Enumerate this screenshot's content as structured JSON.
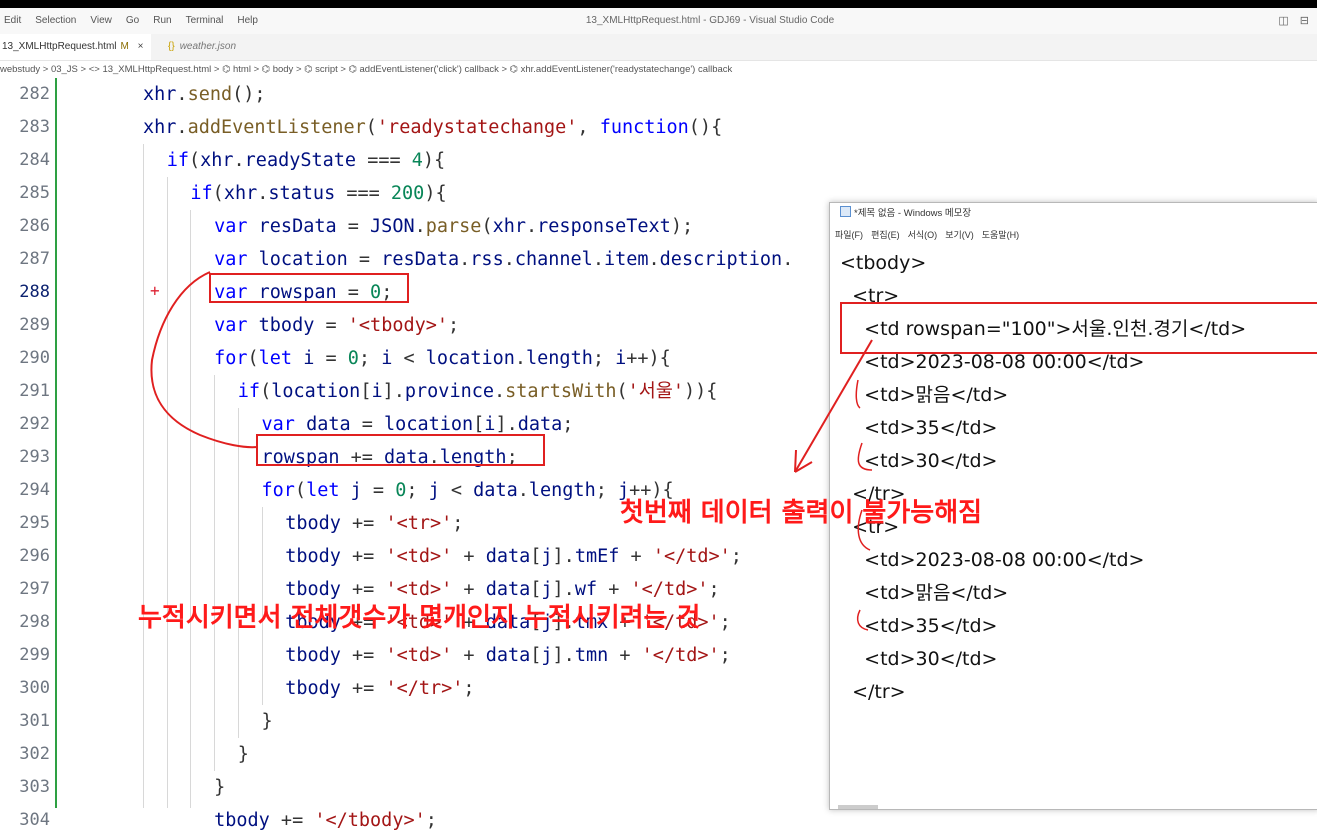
{
  "menubar": {
    "items": [
      "Edit",
      "Selection",
      "View",
      "Go",
      "Run",
      "Terminal",
      "Help"
    ],
    "window_title": "13_XMLHttpRequest.html - GDJ69 - Visual Studio Code",
    "layout_icons": "◫ ⊟"
  },
  "tabs": {
    "active": {
      "name": "13_XMLHttpRequest.html",
      "mod": "M",
      "close": "×"
    },
    "inactive": {
      "icon": "{}",
      "name": "weather.json"
    }
  },
  "breadcrumb": "webstudy > 03_JS > <> 13_XMLHttpRequest.html > ⌬ html > ⌬ body > ⌬ script > ⌬ addEventListener('click') callback > ⌬ xhr.addEventListener('readystatechange') callback",
  "editor": {
    "current_line": 288,
    "added_marker": "+",
    "lines": [
      {
        "n": "282",
        "indent": 0,
        "tokens": [
          [
            "var",
            "xhr"
          ],
          [
            "p",
            "."
          ],
          [
            "fn",
            "send"
          ],
          [
            "p",
            "();"
          ]
        ]
      },
      {
        "n": "283",
        "indent": 0,
        "tokens": [
          [
            "var",
            "xhr"
          ],
          [
            "p",
            "."
          ],
          [
            "fn",
            "addEventListener"
          ],
          [
            "p",
            "("
          ],
          [
            "str",
            "'readystatechange'"
          ],
          [
            "p",
            ", "
          ],
          [
            "kw",
            "function"
          ],
          [
            "p",
            "(){"
          ]
        ]
      },
      {
        "n": "284",
        "indent": 1,
        "tokens": [
          [
            "kw",
            "if"
          ],
          [
            "p",
            "("
          ],
          [
            "var",
            "xhr"
          ],
          [
            "p",
            "."
          ],
          [
            "var",
            "readyState"
          ],
          [
            "p",
            " === "
          ],
          [
            "num",
            "4"
          ],
          [
            "p",
            "){"
          ]
        ]
      },
      {
        "n": "285",
        "indent": 2,
        "tokens": [
          [
            "kw",
            "if"
          ],
          [
            "p",
            "("
          ],
          [
            "var",
            "xhr"
          ],
          [
            "p",
            "."
          ],
          [
            "var",
            "status"
          ],
          [
            "p",
            " === "
          ],
          [
            "num",
            "200"
          ],
          [
            "p",
            "){"
          ]
        ]
      },
      {
        "n": "286",
        "indent": 3,
        "tokens": [
          [
            "kw",
            "var"
          ],
          [
            "p",
            " "
          ],
          [
            "var",
            "resData"
          ],
          [
            "p",
            " = "
          ],
          [
            "var",
            "JSON"
          ],
          [
            "p",
            "."
          ],
          [
            "fn",
            "parse"
          ],
          [
            "p",
            "("
          ],
          [
            "var",
            "xhr"
          ],
          [
            "p",
            "."
          ],
          [
            "var",
            "responseText"
          ],
          [
            "p",
            ");"
          ]
        ]
      },
      {
        "n": "287",
        "indent": 3,
        "tokens": [
          [
            "kw",
            "var"
          ],
          [
            "p",
            " "
          ],
          [
            "var",
            "location"
          ],
          [
            "p",
            " = "
          ],
          [
            "var",
            "resData"
          ],
          [
            "p",
            "."
          ],
          [
            "var",
            "rss"
          ],
          [
            "p",
            "."
          ],
          [
            "var",
            "channel"
          ],
          [
            "p",
            "."
          ],
          [
            "var",
            "item"
          ],
          [
            "p",
            "."
          ],
          [
            "var",
            "description"
          ],
          [
            "p",
            "."
          ]
        ]
      },
      {
        "n": "288",
        "indent": 3,
        "tokens": [
          [
            "kw",
            "var"
          ],
          [
            "p",
            " "
          ],
          [
            "var",
            "rowspan"
          ],
          [
            "p",
            " = "
          ],
          [
            "num",
            "0"
          ],
          [
            "p",
            ";"
          ]
        ]
      },
      {
        "n": "289",
        "indent": 3,
        "tokens": [
          [
            "kw",
            "var"
          ],
          [
            "p",
            " "
          ],
          [
            "var",
            "tbody"
          ],
          [
            "p",
            " = "
          ],
          [
            "str",
            "'<tbody>'"
          ],
          [
            "p",
            ";"
          ]
        ]
      },
      {
        "n": "290",
        "indent": 3,
        "tokens": [
          [
            "kw",
            "for"
          ],
          [
            "p",
            "("
          ],
          [
            "kw",
            "let"
          ],
          [
            "p",
            " "
          ],
          [
            "var",
            "i"
          ],
          [
            "p",
            " = "
          ],
          [
            "num",
            "0"
          ],
          [
            "p",
            "; "
          ],
          [
            "var",
            "i"
          ],
          [
            "p",
            " < "
          ],
          [
            "var",
            "location"
          ],
          [
            "p",
            "."
          ],
          [
            "var",
            "length"
          ],
          [
            "p",
            "; "
          ],
          [
            "var",
            "i"
          ],
          [
            "p",
            "++){"
          ]
        ]
      },
      {
        "n": "291",
        "indent": 4,
        "tokens": [
          [
            "kw",
            "if"
          ],
          [
            "p",
            "("
          ],
          [
            "var",
            "location"
          ],
          [
            "p",
            "["
          ],
          [
            "var",
            "i"
          ],
          [
            "p",
            "]."
          ],
          [
            "var",
            "province"
          ],
          [
            "p",
            "."
          ],
          [
            "fn",
            "startsWith"
          ],
          [
            "p",
            "("
          ],
          [
            "str",
            "'서울'"
          ],
          [
            "p",
            "))"
          ],
          [
            "p",
            "{"
          ]
        ]
      },
      {
        "n": "292",
        "indent": 5,
        "tokens": [
          [
            "kw",
            "var"
          ],
          [
            "p",
            " "
          ],
          [
            "var",
            "data"
          ],
          [
            "p",
            " = "
          ],
          [
            "var",
            "location"
          ],
          [
            "p",
            "["
          ],
          [
            "var",
            "i"
          ],
          [
            "p",
            "]."
          ],
          [
            "var",
            "data"
          ],
          [
            "p",
            ";"
          ]
        ]
      },
      {
        "n": "293",
        "indent": 5,
        "tokens": [
          [
            "var",
            "rowspan"
          ],
          [
            "p",
            " += "
          ],
          [
            "var",
            "data"
          ],
          [
            "p",
            "."
          ],
          [
            "var",
            "length"
          ],
          [
            "p",
            ";"
          ]
        ]
      },
      {
        "n": "294",
        "indent": 5,
        "tokens": [
          [
            "kw",
            "for"
          ],
          [
            "p",
            "("
          ],
          [
            "kw",
            "let"
          ],
          [
            "p",
            " "
          ],
          [
            "var",
            "j"
          ],
          [
            "p",
            " = "
          ],
          [
            "num",
            "0"
          ],
          [
            "p",
            "; "
          ],
          [
            "var",
            "j"
          ],
          [
            "p",
            " < "
          ],
          [
            "var",
            "data"
          ],
          [
            "p",
            "."
          ],
          [
            "var",
            "length"
          ],
          [
            "p",
            "; "
          ],
          [
            "var",
            "j"
          ],
          [
            "p",
            "++){"
          ]
        ]
      },
      {
        "n": "295",
        "indent": 6,
        "tokens": [
          [
            "var",
            "tbody"
          ],
          [
            "p",
            " += "
          ],
          [
            "str",
            "'<tr>'"
          ],
          [
            "p",
            ";"
          ]
        ]
      },
      {
        "n": "296",
        "indent": 6,
        "tokens": [
          [
            "var",
            "tbody"
          ],
          [
            "p",
            " += "
          ],
          [
            "str",
            "'<td>'"
          ],
          [
            "p",
            " + "
          ],
          [
            "var",
            "data"
          ],
          [
            "p",
            "["
          ],
          [
            "var",
            "j"
          ],
          [
            "p",
            "]."
          ],
          [
            "var",
            "tmEf"
          ],
          [
            "p",
            " + "
          ],
          [
            "str",
            "'</td>'"
          ],
          [
            "p",
            ";"
          ]
        ]
      },
      {
        "n": "297",
        "indent": 6,
        "tokens": [
          [
            "var",
            "tbody"
          ],
          [
            "p",
            " += "
          ],
          [
            "str",
            "'<td>'"
          ],
          [
            "p",
            " + "
          ],
          [
            "var",
            "data"
          ],
          [
            "p",
            "["
          ],
          [
            "var",
            "j"
          ],
          [
            "p",
            "]."
          ],
          [
            "var",
            "wf"
          ],
          [
            "p",
            " + "
          ],
          [
            "str",
            "'</td>'"
          ],
          [
            "p",
            ";"
          ]
        ]
      },
      {
        "n": "298",
        "indent": 6,
        "tokens": [
          [
            "var",
            "tbody"
          ],
          [
            "p",
            " += "
          ],
          [
            "str",
            "'<td>'"
          ],
          [
            "p",
            " + "
          ],
          [
            "var",
            "data"
          ],
          [
            "p",
            "["
          ],
          [
            "var",
            "j"
          ],
          [
            "p",
            "]."
          ],
          [
            "var",
            "tmx"
          ],
          [
            "p",
            " + "
          ],
          [
            "str",
            "'</td>'"
          ],
          [
            "p",
            ";"
          ]
        ]
      },
      {
        "n": "299",
        "indent": 6,
        "tokens": [
          [
            "var",
            "tbody"
          ],
          [
            "p",
            " += "
          ],
          [
            "str",
            "'<td>'"
          ],
          [
            "p",
            " + "
          ],
          [
            "var",
            "data"
          ],
          [
            "p",
            "["
          ],
          [
            "var",
            "j"
          ],
          [
            "p",
            "]."
          ],
          [
            "var",
            "tmn"
          ],
          [
            "p",
            " + "
          ],
          [
            "str",
            "'</td>'"
          ],
          [
            "p",
            ";"
          ]
        ]
      },
      {
        "n": "300",
        "indent": 6,
        "tokens": [
          [
            "var",
            "tbody"
          ],
          [
            "p",
            " += "
          ],
          [
            "str",
            "'</tr>'"
          ],
          [
            "p",
            ";"
          ]
        ]
      },
      {
        "n": "301",
        "indent": 5,
        "tokens": [
          [
            "p",
            "}"
          ]
        ]
      },
      {
        "n": "302",
        "indent": 4,
        "tokens": [
          [
            "p",
            "}"
          ]
        ]
      },
      {
        "n": "303",
        "indent": 3,
        "tokens": [
          [
            "p",
            "}"
          ]
        ]
      },
      {
        "n": "304",
        "indent": 3,
        "tokens": [
          [
            "var",
            "tbody"
          ],
          [
            "p",
            " += "
          ],
          [
            "str",
            "'</tbody>'"
          ],
          [
            "p",
            ";"
          ]
        ]
      }
    ]
  },
  "notepad": {
    "title": "*제목 없음 - Windows 메모장",
    "menu": [
      "파일(F)",
      "편집(E)",
      "서식(O)",
      "보기(V)",
      "도움말(H)"
    ],
    "lines": [
      "<tbody>",
      "  <tr>",
      "    <td rowspan=\"100\">서울.인천.경기</td>",
      "    <td>2023-08-08 00:00</td>",
      "    <td>맑음</td>",
      "    <td>35</td>",
      "    <td>30</td>",
      "  </tr>",
      "  <tr>",
      "    <td>2023-08-08 00:00</td>",
      "    <td>맑음</td>",
      "    <td>35</td>",
      "    <td>30</td>",
      "  </tr>"
    ]
  },
  "annotations": {
    "first_data_output": "첫번째 데이터 출력이 불가능해짐",
    "accumulate_total": "누적시키면서 전체갯수가 몇개인지 누적시키려는 것"
  },
  "colors": {
    "keyword": "#0000ff",
    "string": "#a31515",
    "number": "#098658",
    "function": "#795e26",
    "variable": "#001080",
    "annotation": "#ff1a1a",
    "git_added": "#2ea043"
  }
}
